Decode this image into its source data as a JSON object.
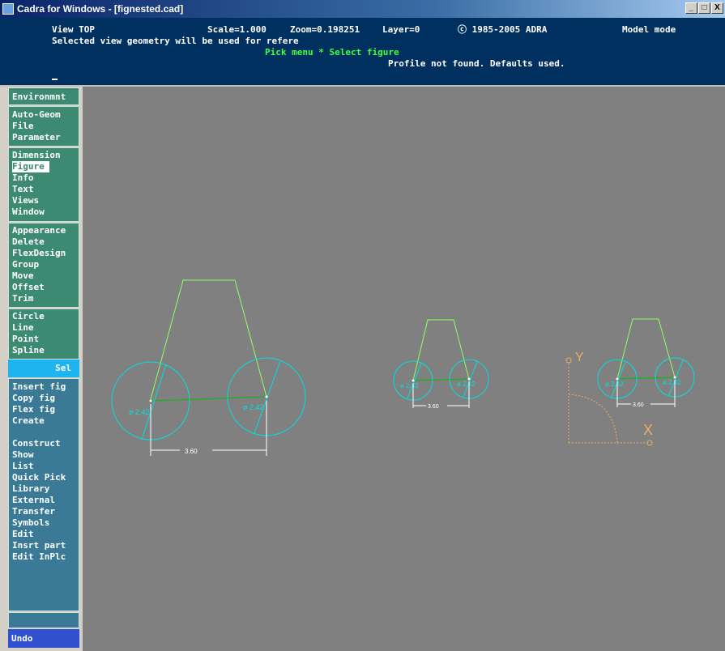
{
  "window": {
    "title": "Cadra for Windows - [fignested.cad]",
    "buttons": {
      "minimize": "_",
      "maximize": "□",
      "close": "X"
    }
  },
  "status": {
    "line1_view": "View TOP",
    "line1_scale": "Scale=1.000",
    "line1_zoom": "Zoom=0.198251",
    "line1_layer": "Layer=0",
    "line1_copyright": "ⓒ 1985-2005 ADRA",
    "line1_mode": "Model mode",
    "line2": "Selected view geometry will be used for refere",
    "line3": "Pick menu * Select figure",
    "line4": "Profile not found. Defaults used."
  },
  "menu": {
    "group1": [
      "Environmnt"
    ],
    "group2": [
      "Auto-Geom",
      "File",
      "Parameter"
    ],
    "group3": [
      "Dimension",
      "Figure",
      "Info",
      "Text",
      "Views",
      "Window"
    ],
    "group4": [
      "Appearance",
      "Delete",
      "FlexDesign",
      "Group",
      "Move",
      "Offset",
      "Trim"
    ],
    "group5": [
      "Circle",
      "Line",
      "Point",
      "Spline"
    ],
    "sel": "Sel",
    "group6": [
      "Insert fig",
      "Copy fig",
      "Flex fig",
      "Create"
    ],
    "group7": [
      "Construct",
      "Show",
      "List",
      "Quick Pick",
      "Library",
      "External",
      "Transfer",
      "Symbols",
      "Edit",
      "Insrt part",
      "Edit InPlc"
    ],
    "undo": "Undo"
  },
  "drawing": {
    "figure1": {
      "diam_left": "ø 2.42",
      "diam_right": "ø 2.42",
      "spacing": "3.60"
    },
    "figure2": {
      "diam_left": "ø 2.42",
      "diam_right": "ø 2.42",
      "spacing": "3.60"
    },
    "figure3": {
      "diam_left": "ø 2.42",
      "diam_right": "ø 2.42",
      "spacing": "3.60"
    },
    "axis": {
      "y_label": "Y",
      "x_label": "X"
    },
    "colors": {
      "circle": "#00e0e0",
      "profile": "#90ff60",
      "centerline": "#00c000",
      "axis": "#e8b060",
      "dimension": "#ffffff"
    }
  }
}
